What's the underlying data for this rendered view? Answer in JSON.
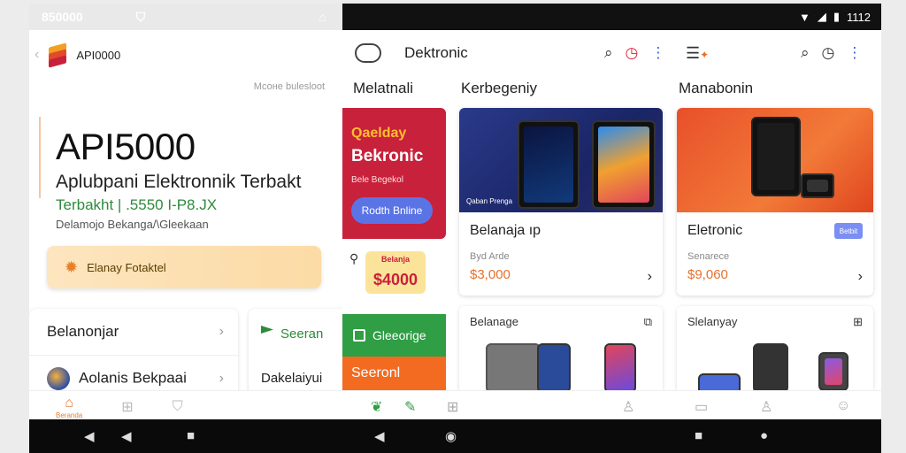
{
  "left": {
    "status_left": "850000",
    "app_name": "API0000",
    "caption": "Мсоне bulesloot",
    "hero_title": "API5000",
    "hero_subtitle": "Aplubpani Elektronnik Terbakt",
    "hero_tag": "Terbakht | .5550 I-P8.JX",
    "hero_desc": "Delamojo Bekanga/\\Gleekaan",
    "cta_label": "Elanay Fotaktel",
    "list": [
      {
        "label": "Belanonjar"
      },
      {
        "label": "Aolanis Bekpaai"
      }
    ],
    "card2_a": "Seeran",
    "card2_b": "Dakelaiyui",
    "nav": [
      {
        "icon": "home-icon",
        "label": "Beranda"
      },
      {
        "icon": "gift-icon"
      },
      {
        "icon": "shield-icon"
      }
    ]
  },
  "right": {
    "status_time": "1112",
    "header_title": "Dektronic",
    "sections": [
      "Melatnali",
      "Kerbegeniy",
      "Manabonin"
    ],
    "promo": {
      "t1": "Qaelday",
      "t2": "Bekronic",
      "t3": "Bele Begekol",
      "btn": "Rodth Bnline"
    },
    "price_small": {
      "top": "Belanja",
      "price": "$4000"
    },
    "green_label": "Gleeorige",
    "orange_label": "Seeronl",
    "product1": {
      "name": "Belanaja ıp",
      "sub": "Byd Arde",
      "price": "$3,000",
      "img_text": "Qaban Prenga"
    },
    "product2": {
      "name": "Eletronic",
      "sub": "Senarece",
      "price": "$9,060",
      "badge": "Betbit"
    },
    "small1": "Belanage",
    "small2": "Slelanyay"
  },
  "colors": {
    "accent": "#e8702a",
    "promo": "#c8213b",
    "green": "#2f9e44",
    "orange": "#f26b21"
  }
}
